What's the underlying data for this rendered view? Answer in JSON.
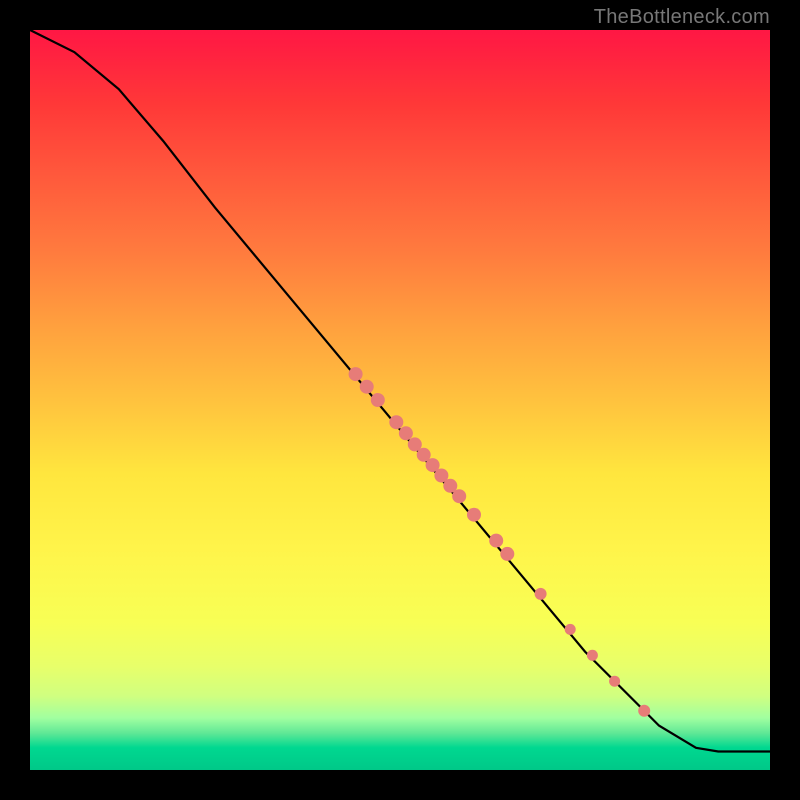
{
  "watermark": "TheBottleneck.com",
  "chart_data": {
    "type": "line",
    "title": "",
    "xlabel": "",
    "ylabel": "",
    "xlim": [
      0,
      100
    ],
    "ylim": [
      0,
      100
    ],
    "curve": [
      {
        "x": 0,
        "y": 100
      },
      {
        "x": 6,
        "y": 97
      },
      {
        "x": 12,
        "y": 92
      },
      {
        "x": 18,
        "y": 85
      },
      {
        "x": 25,
        "y": 76
      },
      {
        "x": 35,
        "y": 64
      },
      {
        "x": 45,
        "y": 52
      },
      {
        "x": 55,
        "y": 40
      },
      {
        "x": 65,
        "y": 28
      },
      {
        "x": 75,
        "y": 16
      },
      {
        "x": 85,
        "y": 6
      },
      {
        "x": 90,
        "y": 3
      },
      {
        "x": 93,
        "y": 2.5
      },
      {
        "x": 100,
        "y": 2.5
      }
    ],
    "markers": [
      {
        "x": 44,
        "y": 53.5,
        "r": 7
      },
      {
        "x": 45.5,
        "y": 51.8,
        "r": 7
      },
      {
        "x": 47,
        "y": 50,
        "r": 7
      },
      {
        "x": 49.5,
        "y": 47,
        "r": 7
      },
      {
        "x": 50.8,
        "y": 45.5,
        "r": 7
      },
      {
        "x": 52,
        "y": 44,
        "r": 7
      },
      {
        "x": 53.2,
        "y": 42.6,
        "r": 7
      },
      {
        "x": 54.4,
        "y": 41.2,
        "r": 7
      },
      {
        "x": 55.6,
        "y": 39.8,
        "r": 7
      },
      {
        "x": 56.8,
        "y": 38.4,
        "r": 7
      },
      {
        "x": 58,
        "y": 37,
        "r": 7
      },
      {
        "x": 60,
        "y": 34.5,
        "r": 7
      },
      {
        "x": 63,
        "y": 31,
        "r": 7
      },
      {
        "x": 64.5,
        "y": 29.2,
        "r": 7
      },
      {
        "x": 69,
        "y": 23.8,
        "r": 6
      },
      {
        "x": 73,
        "y": 19,
        "r": 5.5
      },
      {
        "x": 76,
        "y": 15.5,
        "r": 5.5
      },
      {
        "x": 79,
        "y": 12,
        "r": 5.5
      },
      {
        "x": 83,
        "y": 8,
        "r": 6
      }
    ]
  }
}
